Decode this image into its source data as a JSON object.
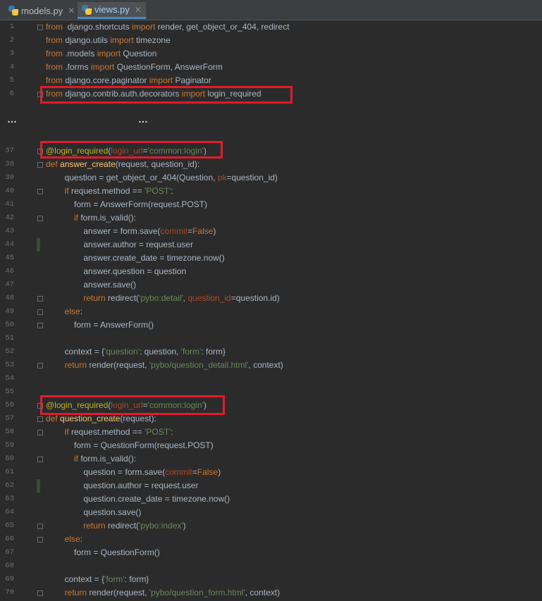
{
  "tabs": [
    {
      "label": "models.py",
      "close": "✕",
      "active": false
    },
    {
      "label": "views.py",
      "close": "✕",
      "active": true
    }
  ],
  "ellipsis": "…",
  "lines": [
    {
      "n": "1",
      "t": [
        [
          "kw",
          "from"
        ],
        [
          "",
          "  django.shortcuts "
        ],
        [
          "kw",
          "import"
        ],
        [
          "",
          " render, get_object_or_404, redirect"
        ]
      ]
    },
    {
      "n": "2",
      "t": [
        [
          "kw",
          "from"
        ],
        [
          "",
          " django.utils "
        ],
        [
          "kw",
          "import"
        ],
        [
          "",
          " timezone"
        ]
      ]
    },
    {
      "n": "3",
      "t": [
        [
          "kw",
          "from"
        ],
        [
          "",
          " .models "
        ],
        [
          "kw",
          "import"
        ],
        [
          "",
          " Question"
        ]
      ]
    },
    {
      "n": "4",
      "t": [
        [
          "kw",
          "from"
        ],
        [
          "",
          " .forms "
        ],
        [
          "kw",
          "import"
        ],
        [
          "",
          " QuestionForm, AnswerForm"
        ]
      ]
    },
    {
      "n": "5",
      "t": [
        [
          "kw",
          "from"
        ],
        [
          "",
          " django.core.paginator "
        ],
        [
          "kw",
          "import"
        ],
        [
          "",
          " Paginator"
        ]
      ]
    },
    {
      "n": "6",
      "t": [
        [
          "kw",
          "from"
        ],
        [
          "",
          " django.contrib.auth.decorators "
        ],
        [
          "kw",
          "import"
        ],
        [
          "",
          " login_required"
        ]
      ]
    },
    {
      "n": "37",
      "t": [
        [
          "dec",
          "@login_required"
        ],
        [
          "",
          "("
        ],
        [
          "param",
          "login_url"
        ],
        [
          "",
          "="
        ],
        [
          "str",
          "'common:login'"
        ],
        [
          "",
          ")"
        ]
      ]
    },
    {
      "n": "38",
      "t": [
        [
          "kw",
          "def"
        ],
        [
          "",
          " "
        ],
        [
          "fn",
          "answer_create"
        ],
        [
          "",
          "(request, question_id):"
        ]
      ]
    },
    {
      "n": "39",
      "t": [
        [
          "",
          "        question = get_object_or_404(Question, "
        ],
        [
          "param",
          "pk"
        ],
        [
          "",
          "=question_id)"
        ]
      ]
    },
    {
      "n": "40",
      "t": [
        [
          "",
          "        "
        ],
        [
          "kw",
          "if"
        ],
        [
          "",
          " request.method == "
        ],
        [
          "str",
          "'POST'"
        ],
        [
          "",
          ":"
        ]
      ]
    },
    {
      "n": "41",
      "t": [
        [
          "",
          "            form = AnswerForm(request.POST)"
        ]
      ]
    },
    {
      "n": "42",
      "t": [
        [
          "",
          "            "
        ],
        [
          "kw",
          "if"
        ],
        [
          "",
          " form.is_valid():"
        ]
      ]
    },
    {
      "n": "43",
      "t": [
        [
          "",
          "                answer = form.save("
        ],
        [
          "param",
          "commit"
        ],
        [
          "",
          "="
        ],
        [
          "kw",
          "False"
        ],
        [
          "",
          ")"
        ]
      ]
    },
    {
      "n": "44",
      "t": [
        [
          "",
          "                answer.author = request.user"
        ]
      ]
    },
    {
      "n": "45",
      "t": [
        [
          "",
          "                answer.create_date = timezone.now()"
        ]
      ]
    },
    {
      "n": "46",
      "t": [
        [
          "",
          "                answer.question = question"
        ]
      ]
    },
    {
      "n": "47",
      "t": [
        [
          "",
          "                answer.save()"
        ]
      ]
    },
    {
      "n": "48",
      "t": [
        [
          "",
          "                "
        ],
        [
          "kw",
          "return"
        ],
        [
          "",
          " redirect("
        ],
        [
          "str",
          "'pybo:detail'"
        ],
        [
          "",
          ", "
        ],
        [
          "param",
          "question_id"
        ],
        [
          "",
          "=question.id)"
        ]
      ]
    },
    {
      "n": "49",
      "t": [
        [
          "",
          "        "
        ],
        [
          "kw",
          "else"
        ],
        [
          "",
          ":"
        ]
      ]
    },
    {
      "n": "50",
      "t": [
        [
          "",
          "            form = AnswerForm()"
        ]
      ]
    },
    {
      "n": "51",
      "t": []
    },
    {
      "n": "52",
      "t": [
        [
          "",
          "        context = {"
        ],
        [
          "str",
          "'question'"
        ],
        [
          "",
          ": question, "
        ],
        [
          "str",
          "'form'"
        ],
        [
          "",
          ": form}"
        ]
      ]
    },
    {
      "n": "53",
      "t": [
        [
          "",
          "        "
        ],
        [
          "kw",
          "return"
        ],
        [
          "",
          " render(request, "
        ],
        [
          "str",
          "'pybo/question_detail.html'"
        ],
        [
          "",
          ", context)"
        ]
      ]
    },
    {
      "n": "54",
      "t": []
    },
    {
      "n": "55",
      "t": []
    },
    {
      "n": "56",
      "t": [
        [
          "dec",
          "@login_required"
        ],
        [
          "",
          "("
        ],
        [
          "param",
          "login_url"
        ],
        [
          "",
          "="
        ],
        [
          "str",
          "'common:login'"
        ],
        [
          "",
          ")"
        ]
      ]
    },
    {
      "n": "57",
      "t": [
        [
          "kw",
          "def"
        ],
        [
          "",
          " "
        ],
        [
          "fn",
          "question_create"
        ],
        [
          "",
          "(request):"
        ]
      ]
    },
    {
      "n": "58",
      "t": [
        [
          "",
          "        "
        ],
        [
          "kw",
          "if"
        ],
        [
          "",
          " request.method == "
        ],
        [
          "str",
          "'POST'"
        ],
        [
          "",
          ":"
        ]
      ]
    },
    {
      "n": "59",
      "t": [
        [
          "",
          "            form = QuestionForm(request.POST)"
        ]
      ]
    },
    {
      "n": "60",
      "t": [
        [
          "",
          "            "
        ],
        [
          "kw",
          "if"
        ],
        [
          "",
          " form.is_valid():"
        ]
      ]
    },
    {
      "n": "61",
      "t": [
        [
          "",
          "                question = form.save("
        ],
        [
          "param",
          "commit"
        ],
        [
          "",
          "="
        ],
        [
          "kw",
          "False"
        ],
        [
          "",
          ")"
        ]
      ]
    },
    {
      "n": "62",
      "t": [
        [
          "",
          "                question.author = request.user"
        ]
      ]
    },
    {
      "n": "63",
      "t": [
        [
          "",
          "                question.create_date = timezone.now()"
        ]
      ]
    },
    {
      "n": "64",
      "t": [
        [
          "",
          "                question.save()"
        ]
      ]
    },
    {
      "n": "65",
      "t": [
        [
          "",
          "                "
        ],
        [
          "kw",
          "return"
        ],
        [
          "",
          " redirect("
        ],
        [
          "str",
          "'pybo:index'"
        ],
        [
          "",
          ")"
        ]
      ]
    },
    {
      "n": "66",
      "t": [
        [
          "",
          "        "
        ],
        [
          "kw",
          "else"
        ],
        [
          "",
          ":"
        ]
      ]
    },
    {
      "n": "67",
      "t": [
        [
          "",
          "            form = QuestionForm()"
        ]
      ]
    },
    {
      "n": "68",
      "t": []
    },
    {
      "n": "69",
      "t": [
        [
          "",
          "        context = {"
        ],
        [
          "str",
          "'form'"
        ],
        [
          "",
          ": form}"
        ]
      ]
    },
    {
      "n": "70",
      "t": [
        [
          "",
          "        "
        ],
        [
          "kw",
          "return"
        ],
        [
          "",
          " render(request, "
        ],
        [
          "str",
          "'pybo/question_form.html'"
        ],
        [
          "",
          ", context)"
        ]
      ]
    }
  ]
}
